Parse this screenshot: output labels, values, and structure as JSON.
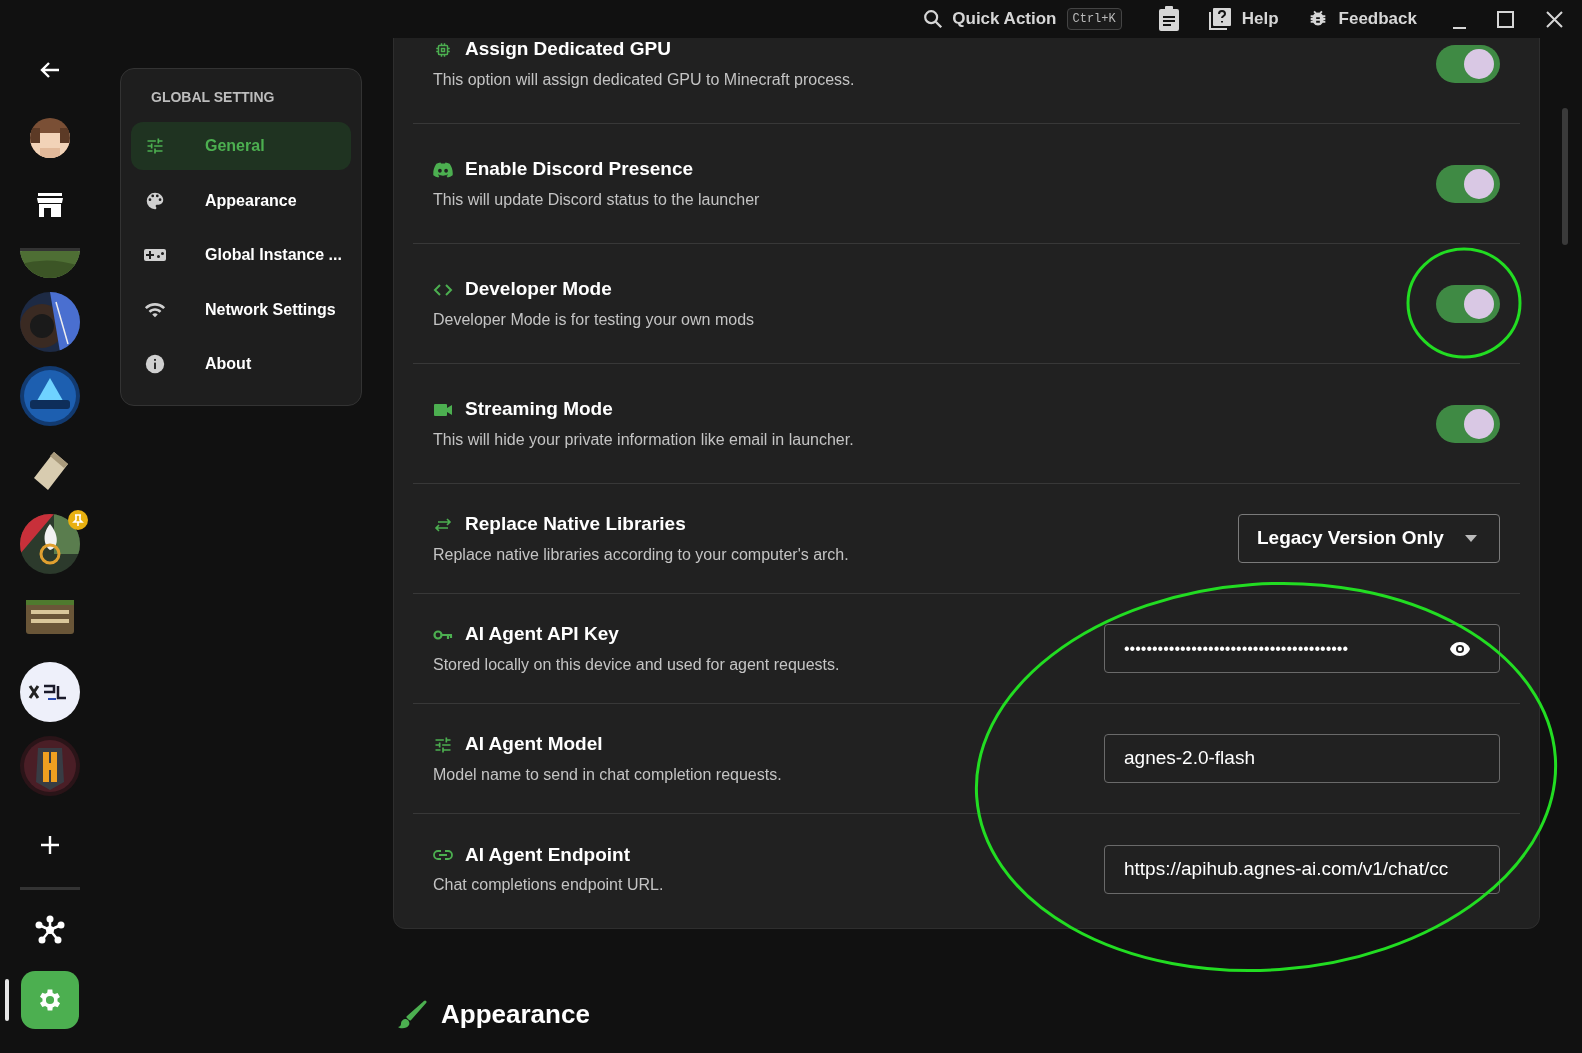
{
  "title_bar": {
    "quick_action": "Quick Action",
    "shortcut": "Ctrl+K",
    "help": "Help",
    "feedback": "Feedback"
  },
  "rail": {
    "nav": [
      {
        "kind": "back",
        "selected": false
      },
      {
        "kind": "avatar",
        "selected": false
      },
      {
        "kind": "store",
        "selected": false
      }
    ],
    "instances": [
      {
        "pinned": false
      },
      {
        "pinned": false
      },
      {
        "pinned": false
      },
      {
        "pinned": false
      },
      {
        "pinned": true
      },
      {
        "pinned": false
      },
      {
        "pinned": false
      },
      {
        "pinned": false
      }
    ],
    "bottom": [
      {
        "kind": "add",
        "selected": false
      },
      {
        "kind": "network",
        "selected": false
      },
      {
        "kind": "settings",
        "selected": true
      }
    ]
  },
  "settings_nav": {
    "heading": "GLOBAL SETTING",
    "items": [
      {
        "label": "General",
        "selected": true
      },
      {
        "label": "Appearance",
        "selected": false
      },
      {
        "label": "Global Instance ...",
        "selected": false
      },
      {
        "label": "Network Settings",
        "selected": false
      },
      {
        "label": "About",
        "selected": false
      }
    ]
  },
  "rows": [
    {
      "kind": "toggle",
      "title": "Assign Dedicated GPU",
      "description": "This option will assign dedicated GPU to Minecraft process.",
      "on": true
    },
    {
      "kind": "toggle",
      "title": "Enable Discord Presence",
      "description": "This will update Discord status to the launcher",
      "on": true
    },
    {
      "kind": "toggle",
      "title": "Developer Mode",
      "description": "Developer Mode is for testing your own mods",
      "on": true
    },
    {
      "kind": "toggle",
      "title": "Streaming Mode",
      "description": "This will hide your private information like email in launcher.",
      "on": true
    },
    {
      "kind": "dropdown",
      "title": "Replace Native Libraries",
      "description": "Replace native libraries according to your computer's arch.",
      "value": "Legacy Version Only"
    },
    {
      "kind": "password",
      "title": "AI Agent API Key",
      "description": "Stored locally on this device and used for agent requests.",
      "value": "••••••••••••••••••••••••••••••••••••••••"
    },
    {
      "kind": "text",
      "title": "AI Agent Model",
      "description": "Model name to send in chat completion requests.",
      "value": "agnes-2.0-flash"
    },
    {
      "kind": "text",
      "title": "AI Agent Endpoint",
      "description": "Chat completions endpoint URL.",
      "value": "https://apihub.agnes-ai.com/v1/chat/cc"
    }
  ],
  "next_section": {
    "title": "Appearance"
  }
}
